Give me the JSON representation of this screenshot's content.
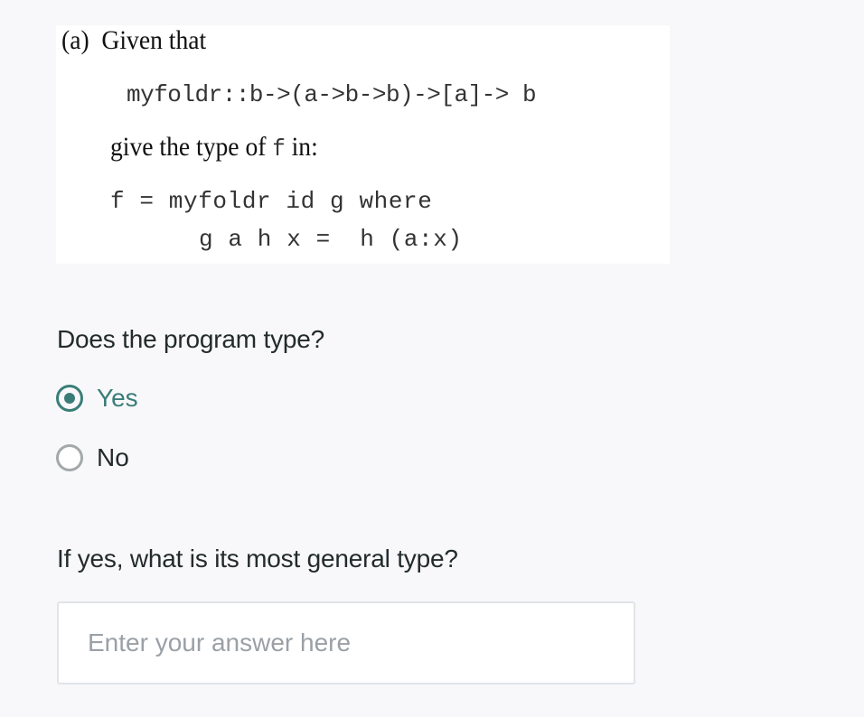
{
  "question_image": {
    "heading": "(a)  Given that",
    "type_signature": "myfoldr::b->(a->b->b)->[a]-> b",
    "instruction_prefix": "give the type of ",
    "instruction_var": "f",
    "instruction_suffix": " in:",
    "code_line_1": "f = myfoldr id g where",
    "code_line_2": "g a h x =  h (a:x)"
  },
  "question_1": {
    "label": "Does the program type?",
    "options": [
      {
        "label": "Yes",
        "selected": true
      },
      {
        "label": "No",
        "selected": false
      }
    ]
  },
  "question_2": {
    "label": "If yes, what is its most general type?",
    "input_value": "",
    "input_placeholder": "Enter your answer here"
  },
  "colors": {
    "accent": "#3a7d78",
    "background": "#f8f8fa",
    "text": "#232b2b",
    "placeholder": "#9aa0a6"
  }
}
